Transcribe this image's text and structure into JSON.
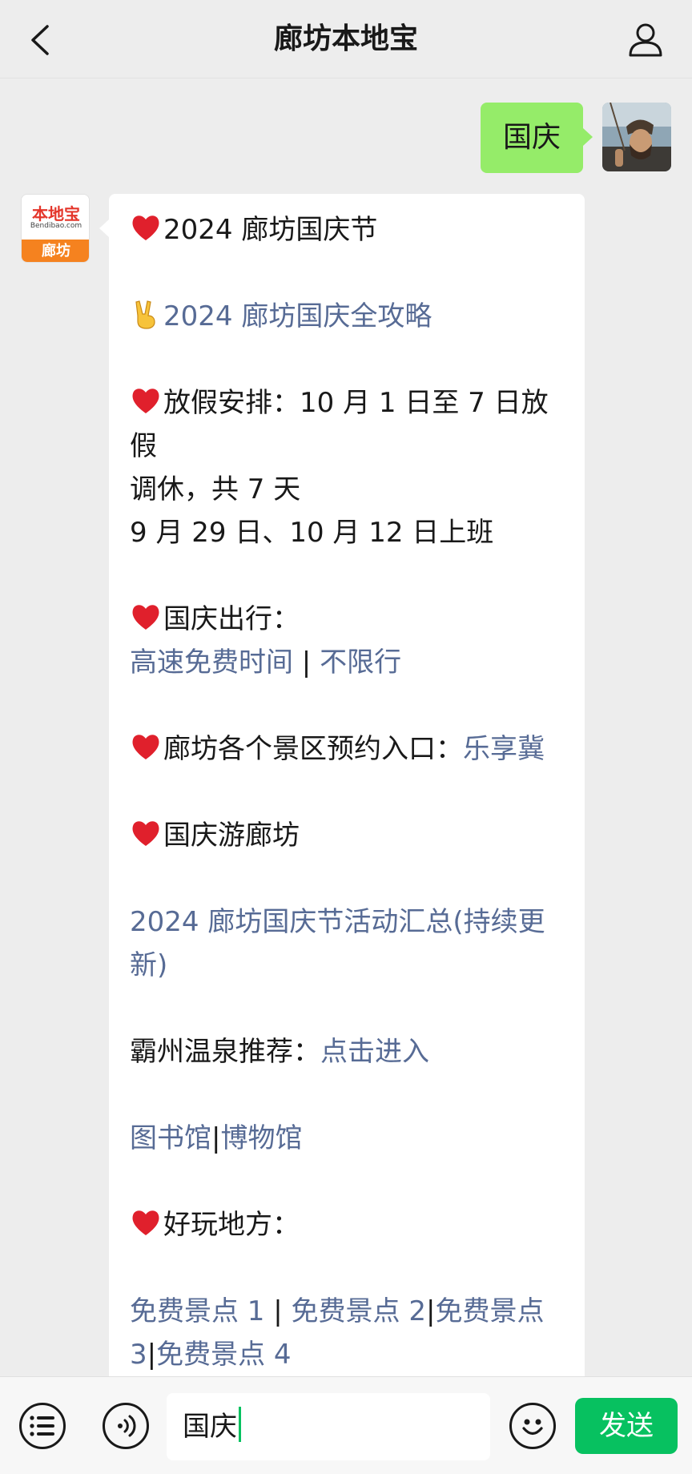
{
  "header": {
    "title": "廊坊本地宝",
    "back_icon": "chevron-left-icon",
    "profile_icon": "person-icon"
  },
  "chat": {
    "user_message": "国庆",
    "bot_avatar": {
      "logo_text": "本地宝",
      "logo_sub": "Bendibao.com",
      "logo_city": "廊坊"
    },
    "reply": {
      "title": "2024 廊坊国庆节",
      "guide_link": "2024 廊坊国庆全攻略",
      "holiday_label": "放假安排：",
      "holiday_text_1": "10 月 1 日至 7 日放假",
      "holiday_text_2": "调休，共 7 天",
      "holiday_text_3": "9 月 29 日、10 月 12 日上班",
      "travel_label": "国庆出行：",
      "travel_link_1": "高速免费时间",
      "separator": " | ",
      "travel_link_2": "不限行",
      "scenic_label": "廊坊各个景区预约入口：",
      "scenic_link": "乐享冀",
      "tour_label": "国庆游廊坊",
      "activity_link": "2024 廊坊国庆节活动汇总(持续更新)",
      "hotspring_label": "霸州温泉推荐：",
      "hotspring_link": "点击进入",
      "library_link": "图书馆",
      "sep_bar": "|",
      "museum_link": "博物馆",
      "fun_label": "好玩地方：",
      "free_1": "免费景点 1",
      "free_sep_1": " | ",
      "free_2": "免费景点 2",
      "free_sep_2": "|",
      "free_3": "免费景点 3",
      "free_sep_3": "|",
      "free_4": "免费景点 4"
    }
  },
  "input_bar": {
    "menu_icon": "list-menu-icon",
    "voice_icon": "voice-icon",
    "input_value": "国庆",
    "emoji_icon": "emoji-icon",
    "send_label": "发送"
  },
  "colors": {
    "link": "#576b95",
    "user_bubble": "#95ec69",
    "send_button": "#07c160",
    "background": "#ededed"
  }
}
